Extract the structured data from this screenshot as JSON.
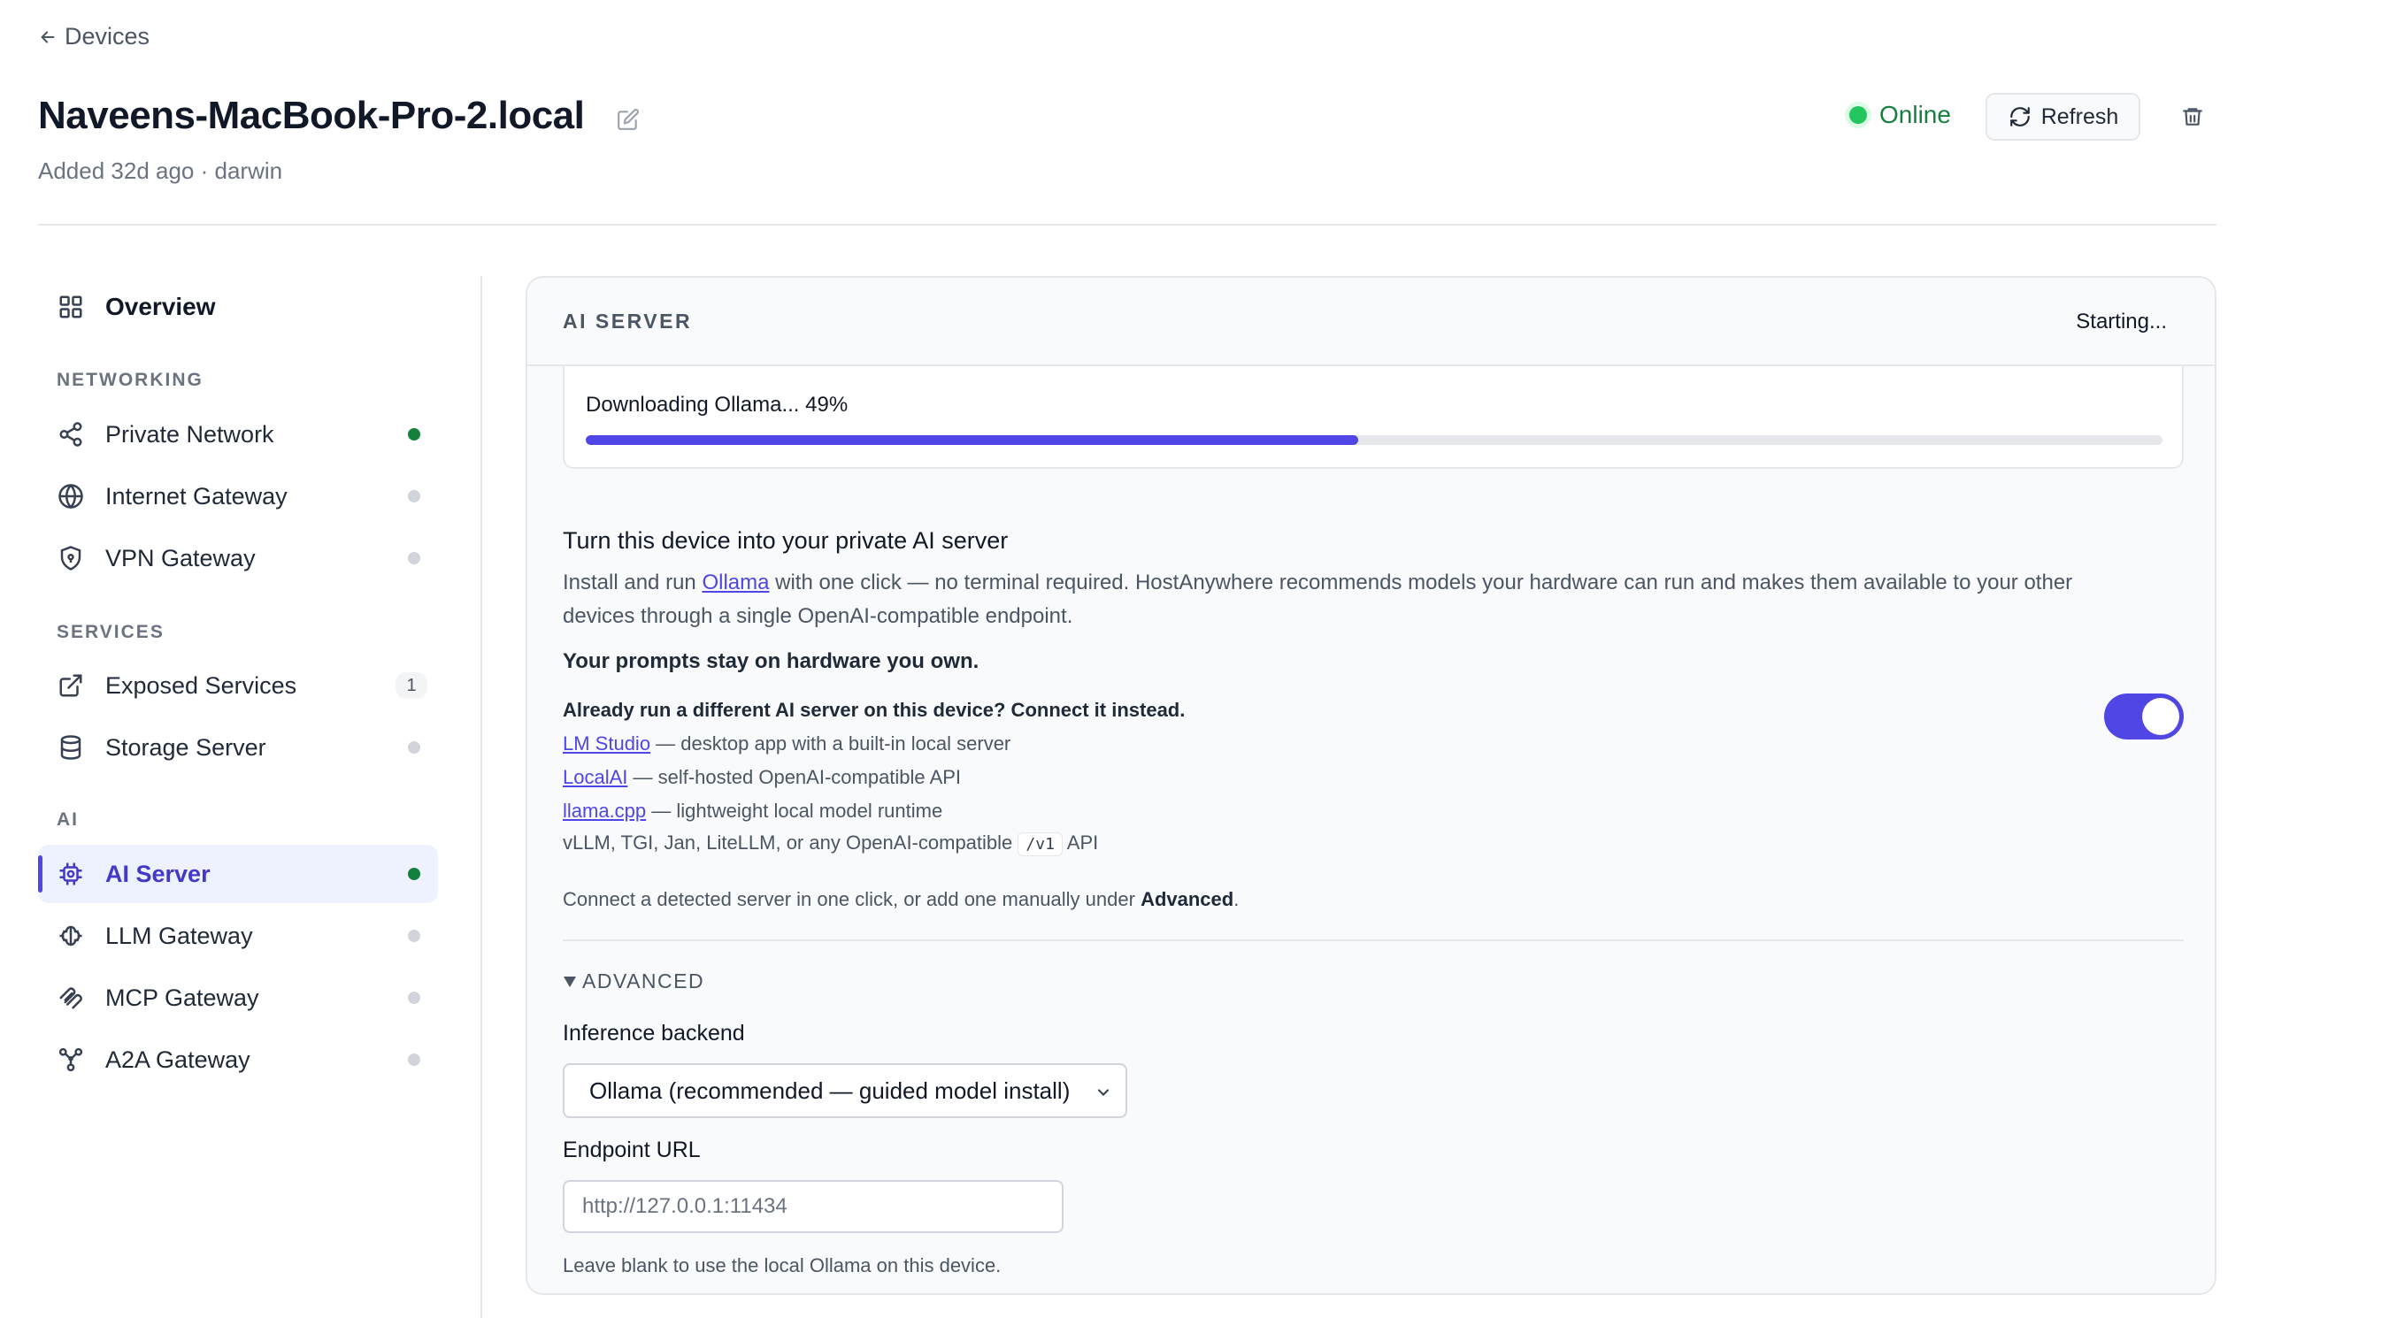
{
  "header": {
    "back_label": "Devices",
    "device_name": "Naveens-MacBook-Pro-2.local",
    "subtitle": "Added 32d ago · darwin",
    "status": "Online",
    "refresh_label": "Refresh"
  },
  "sidebar": {
    "overview": "Overview",
    "sections": {
      "networking": "NETWORKING",
      "services": "SERVICES",
      "ai": "AI"
    },
    "items": {
      "private_network": "Private Network",
      "internet_gateway": "Internet Gateway",
      "vpn_gateway": "VPN Gateway",
      "exposed_services": "Exposed Services",
      "exposed_services_count": "1",
      "storage_server": "Storage Server",
      "ai_server": "AI Server",
      "llm_gateway": "LLM Gateway",
      "mcp_gateway": "MCP Gateway",
      "a2a_gateway": "A2A Gateway"
    }
  },
  "card": {
    "heading": "AI SERVER",
    "state": "Starting...",
    "progress_text": "Downloading Ollama... 49%",
    "progress_value": 0.49,
    "section_title": "Turn this device into your private AI server",
    "desc_before": "Install and run ",
    "desc_link": "Ollama",
    "desc_after": " with one click — no terminal required. HostAnywhere recommends models your hardware can run and makes them available to your other devices through a single OpenAI-compatible endpoint.",
    "strong_line": "Your prompts stay on hardware you own.",
    "connect_heading": "Already run a different AI server on this device? Connect it instead.",
    "toggle_on": true,
    "servers": [
      {
        "link": "LM Studio",
        "text": " — desktop app with a built-in local server"
      },
      {
        "link": "LocalAI",
        "text": " — self-hosted OpenAI-compatible API"
      },
      {
        "link": "llama.cpp",
        "text": " — lightweight local model runtime"
      }
    ],
    "other_servers_before": "vLLM, TGI, Jan, LiteLLM, or any OpenAI-compatible ",
    "other_servers_code": "/v1",
    "other_servers_after": " API",
    "hint_before": "Connect a detected server in one click, or add one manually under ",
    "hint_bold": "Advanced",
    "hint_after": ".",
    "advanced_label": "ADVANCED",
    "backend_label": "Inference backend",
    "backend_value": "Ollama (recommended — guided model install)",
    "endpoint_label": "Endpoint URL",
    "endpoint_placeholder": "http://127.0.0.1:11434",
    "endpoint_help": "Leave blank to use the local Ollama on this device."
  },
  "colors": {
    "accent": "#4f46e5",
    "online": "#22c55e",
    "online_text": "#15803d"
  }
}
